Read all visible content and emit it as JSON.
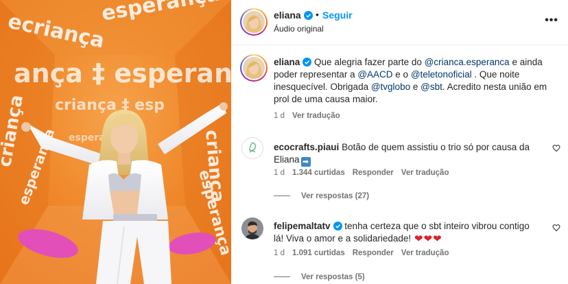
{
  "media": {
    "alt": "Foto de Eliana em túnel laranja com logo Criança Esperança",
    "pattern_words": [
      "criança",
      "esperança"
    ]
  },
  "header": {
    "username": "eliana",
    "separator": "•",
    "follow_label": "Seguir",
    "audio_label": "Áudio original",
    "more_label": "•••"
  },
  "caption": {
    "username": "eliana",
    "t1": "Que alegria fazer parte do ",
    "m1": "@crianca.esperanca",
    "t2": " e ainda poder representar a ",
    "m2": "@AACD",
    "t3": " e o ",
    "m3": "@teletonoficial",
    "t4": " . Que noite inesquecível. Obrigada ",
    "m4": "@tvglobo",
    "t5": " e ",
    "m5": "@sbt",
    "t6": ". Acredito nesta união em prol de uma causa maior.",
    "time": "1 d",
    "translate": "Ver tradução"
  },
  "comments": [
    {
      "username": "ecocrafts.piaui",
      "text": "Botão de quem assistiu o trio só por causa da Eliana",
      "time": "1 d",
      "likes": "1.344 curtidas",
      "reply": "Responder",
      "translate": "Ver tradução",
      "replies": "Ver respostas (27)"
    },
    {
      "username": "felipemaltatv",
      "text": "tenha certeza que o sbt inteiro vibrou contigo lá! Viva o amor e a solidariedade!",
      "time": "1 d",
      "likes": "1.091 curtidas",
      "reply": "Responder",
      "translate": "Ver tradução",
      "replies": "Ver respostas (5)"
    }
  ],
  "colors": {
    "accent_blue": "#0095f6",
    "mention": "#00376b",
    "muted": "#737373",
    "media_orange": "#f07f22"
  }
}
